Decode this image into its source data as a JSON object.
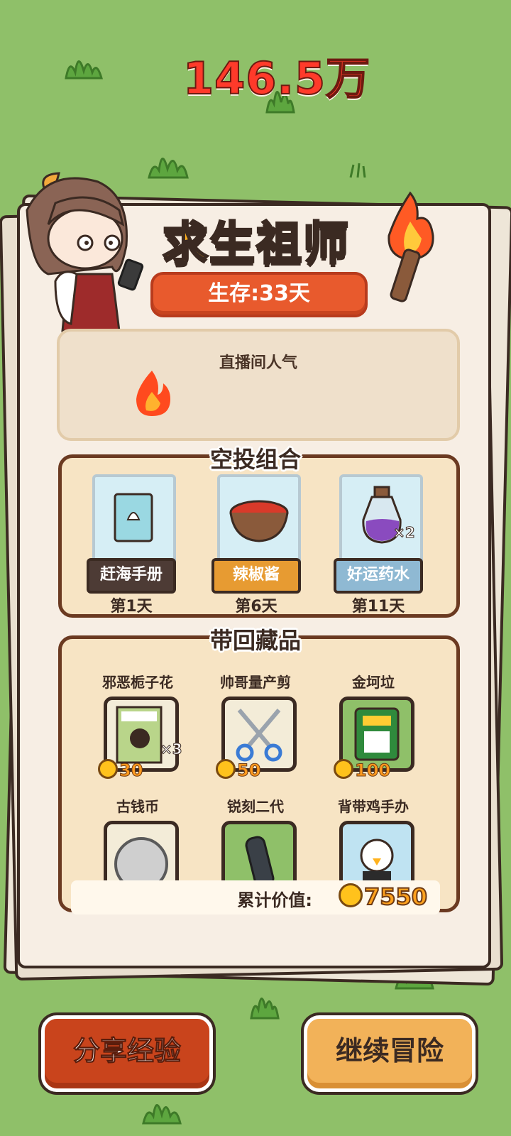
{
  "title": "求生祖师",
  "survival_days": "生存:33天",
  "popularity": {
    "label": "直播间人气",
    "value": "146.5万"
  },
  "airdrop": {
    "title": "空投组合",
    "items": [
      {
        "name": "赶海手册",
        "day": "第1天",
        "icon": "shell-book-icon",
        "label_color": "#4d3b35"
      },
      {
        "name": "辣椒酱",
        "day": "第6天",
        "icon": "chili-sauce-bowl-icon",
        "label_color": "#e79b32"
      },
      {
        "name": "好运药水",
        "day": "第11天",
        "icon": "potion-bottle-icon",
        "label_color": "#8fb9d3",
        "count": "×2"
      }
    ]
  },
  "collection": {
    "title": "带回藏品",
    "items": [
      {
        "name": "邪恶栀子花",
        "price": "30",
        "icon": "book-portrait-icon",
        "count": "×3"
      },
      {
        "name": "帅哥量产剪",
        "price": "50",
        "icon": "scissors-icon"
      },
      {
        "name": "金坷垃",
        "price": "100",
        "icon": "fertilizer-bag-icon"
      },
      {
        "name": "古钱币",
        "icon": "ancient-coin-icon"
      },
      {
        "name": "锐刻二代",
        "icon": "vape-device-icon"
      },
      {
        "name": "背带鸡手办",
        "icon": "chicken-figure-icon"
      }
    ],
    "total_label": "累计价值:",
    "total_value": "7550"
  },
  "buttons": {
    "share": "分享经验",
    "continue": "继续冒险"
  },
  "colors": {
    "background": "#8fc069",
    "title": "#ffb01f",
    "days_banner": "#e85a2d",
    "popularity_value": "#ff3a2a",
    "share_button": "#c9441c",
    "continue_button": "#f2b259"
  }
}
